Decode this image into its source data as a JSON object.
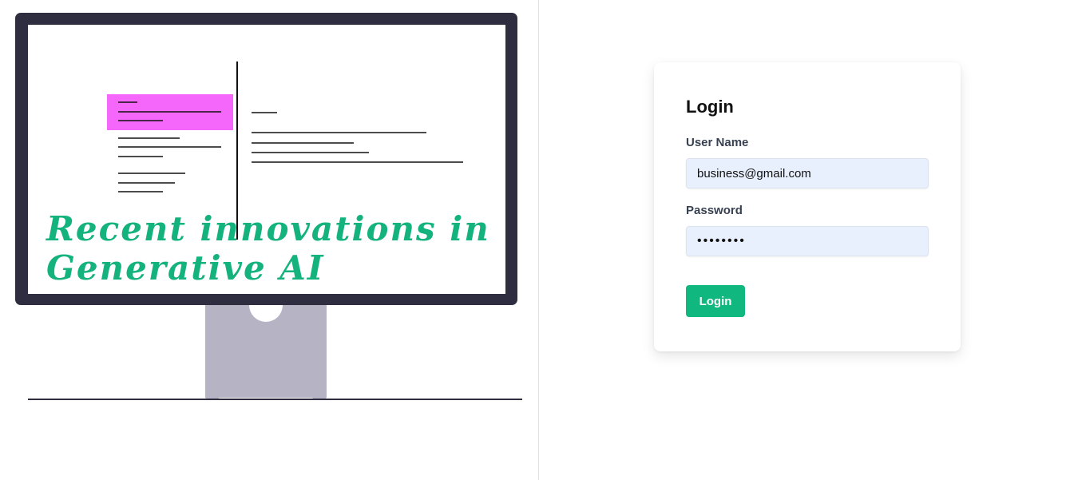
{
  "hero": {
    "title_line1": "Recent innovations in",
    "title_line2": "Generative AI"
  },
  "login": {
    "title": "Login",
    "username_label": "User Name",
    "username_value": "business@gmail.com",
    "password_label": "Password",
    "password_value": "password",
    "button_label": "Login"
  },
  "colors": {
    "accent": "#10b77f",
    "highlight": "#f566fb",
    "monitor_frame": "#2f2e41",
    "stand": "#b6b3c5",
    "input_bg": "#e8f0fe"
  }
}
